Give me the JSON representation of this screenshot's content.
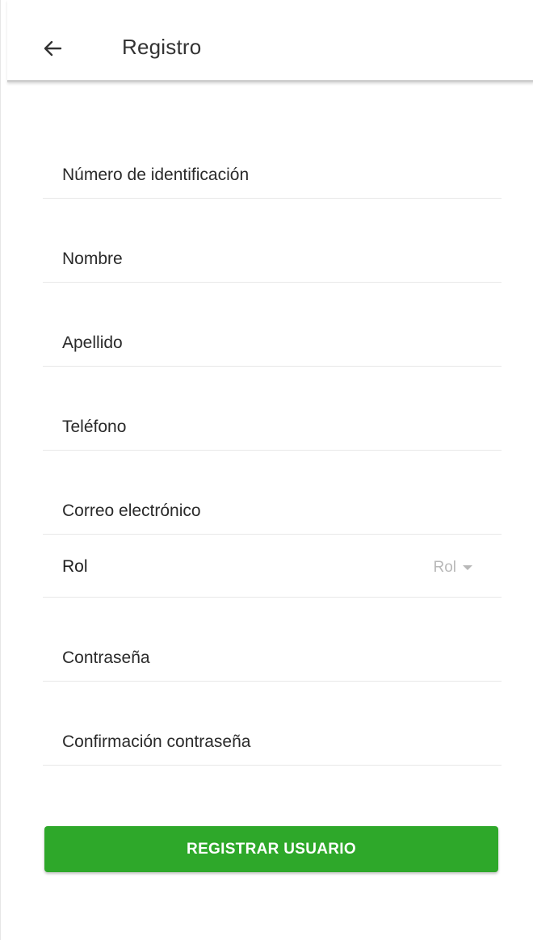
{
  "header": {
    "title": "Registro",
    "back_icon": "arrow-left-icon"
  },
  "form": {
    "id_number": {
      "placeholder": "Número de identificación",
      "value": ""
    },
    "first_name": {
      "placeholder": "Nombre",
      "value": ""
    },
    "last_name": {
      "placeholder": "Apellido",
      "value": ""
    },
    "phone": {
      "placeholder": "Teléfono",
      "value": ""
    },
    "email": {
      "placeholder": "Correo electrónico",
      "value": ""
    },
    "role": {
      "label": "Rol",
      "selected": "Rol",
      "icon": "caret-down-icon"
    },
    "password": {
      "placeholder": "Contraseña",
      "value": ""
    },
    "password_confirm": {
      "placeholder": "Confirmación contraseña",
      "value": ""
    }
  },
  "actions": {
    "submit_label": "REGISTRAR USUARIO"
  },
  "colors": {
    "primary_button": "#2ea82a",
    "button_text": "#ffffff",
    "placeholder_muted": "#b8b8b8"
  }
}
